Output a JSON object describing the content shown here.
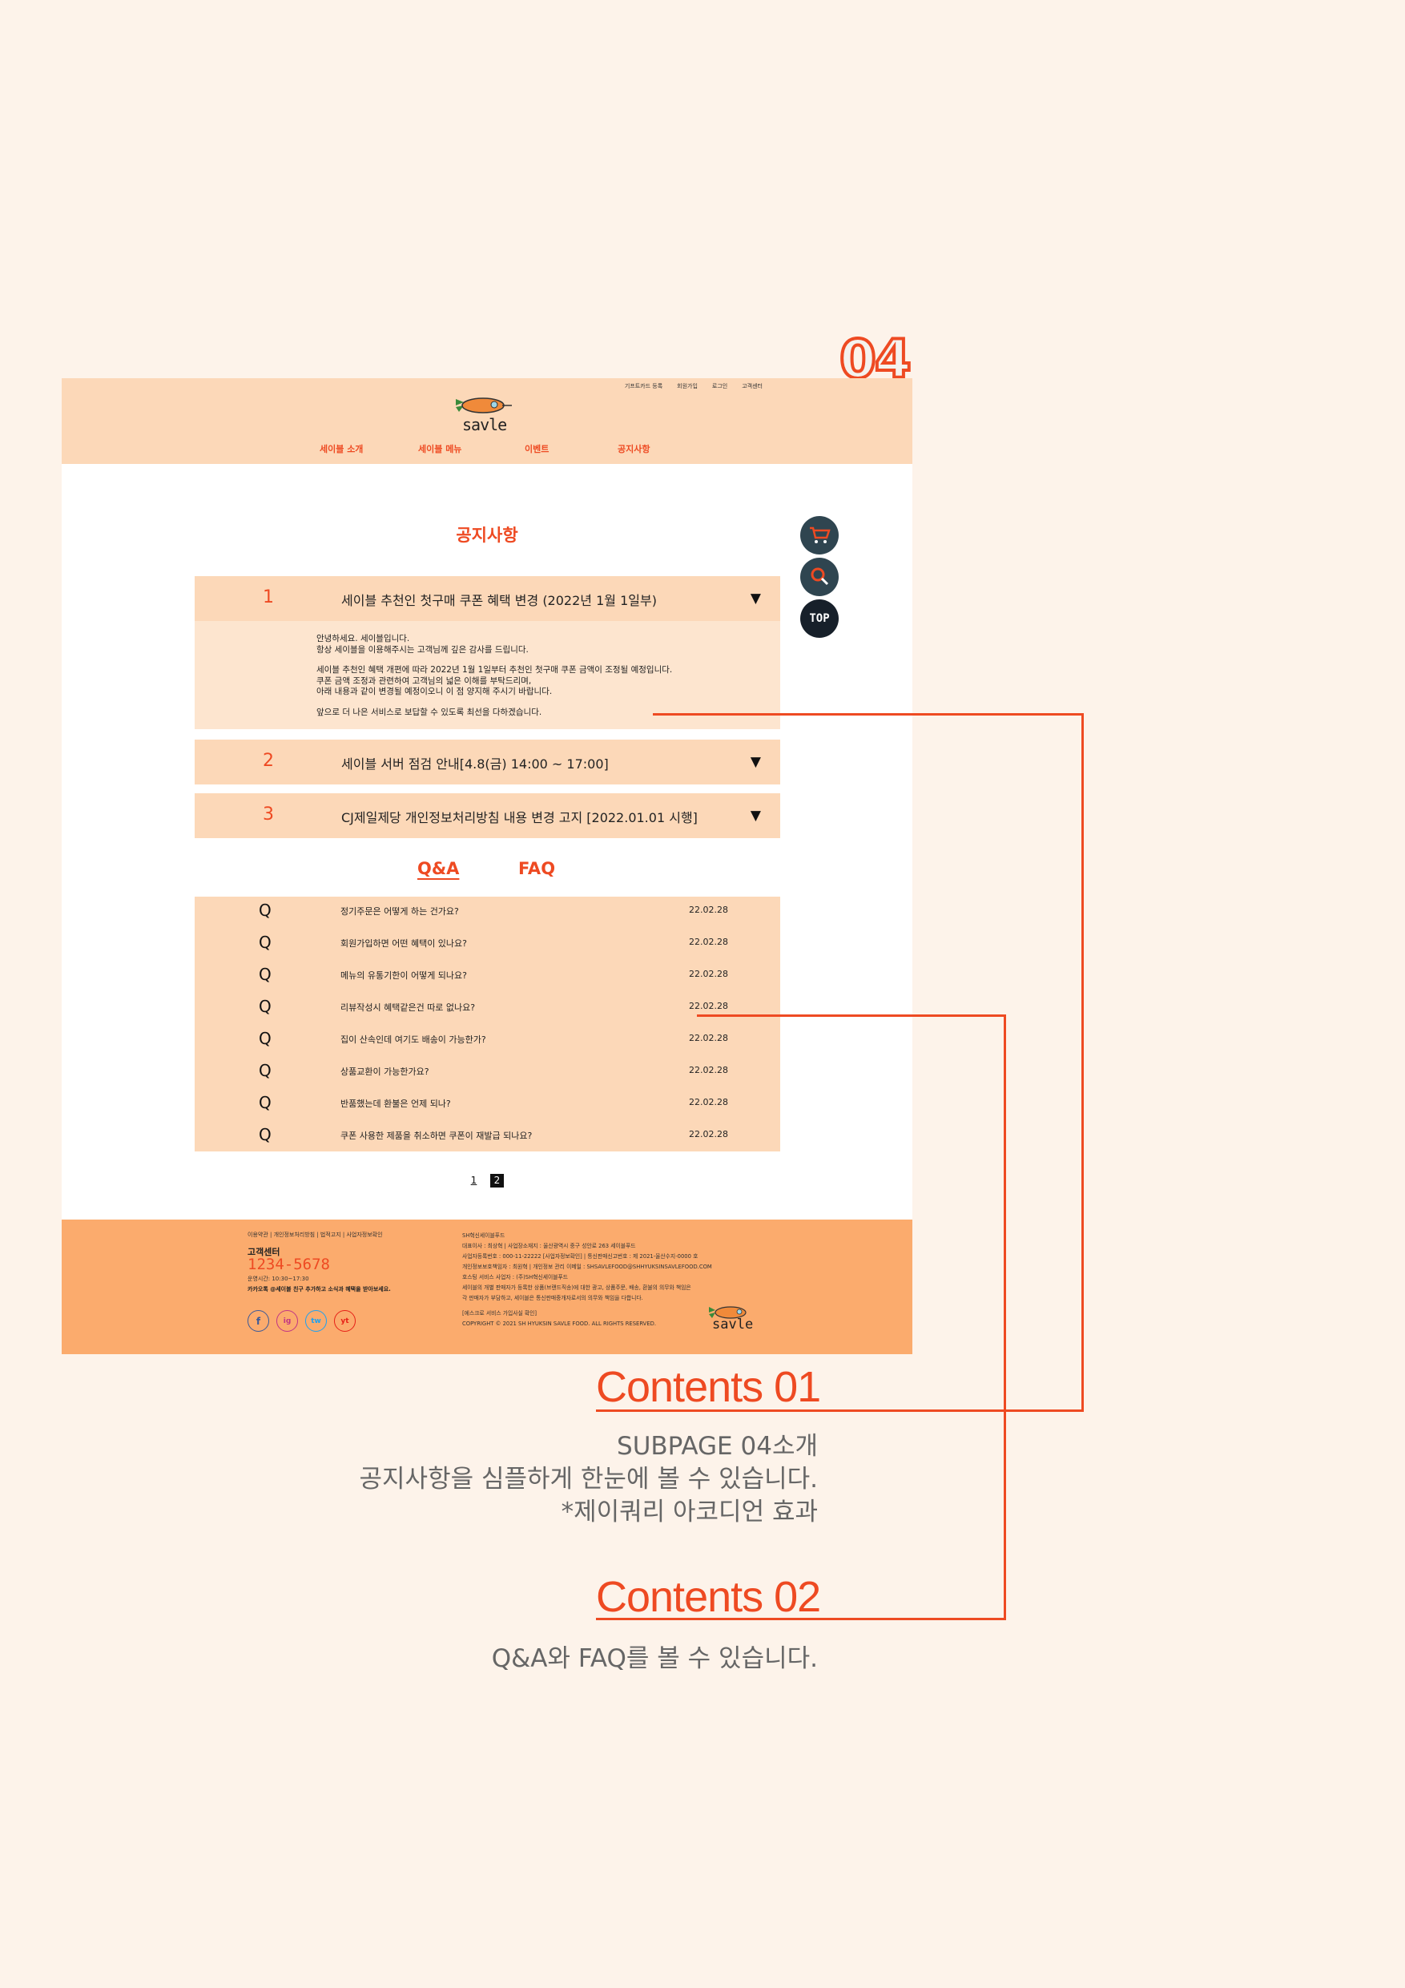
{
  "page_number": "04",
  "site": {
    "util_links": [
      "기프트카드 등록",
      "회원가입",
      "로그인",
      "고객센터"
    ],
    "logo_text": "savle",
    "nav": [
      "세이블 소개",
      "세이블 메뉴",
      "이벤트",
      "공지사항"
    ]
  },
  "notice": {
    "title": "공지사항",
    "items": [
      {
        "num": "1",
        "title": "세이블 추천인 첫구매 쿠폰 혜택 변경 (2022년 1월 1일부)",
        "body": [
          "안녕하세요. 세이블입니다.",
          "항상 세이블을 이용해주시는 고객님께 깊은 감사를 드립니다.",
          "",
          "세이블 추천인 혜택 개편에 따라 2022년 1월 1일부터 추천인 첫구매 쿠폰 금액이 조정될 예정입니다.",
          "쿠폰 금액 조정과 관련하여 고객님의 넓은 이해를 부탁드리며,",
          "아래 내용과 같이 변경될 예정이오니 이 점 양지해 주시기 바랍니다.",
          "",
          "앞으로 더 나은 서비스로 보답할 수 있도록 최선을 다하겠습니다."
        ]
      },
      {
        "num": "2",
        "title": "세이블 서버 점검 안내[4.8(금) 14:00 ~ 17:00]"
      },
      {
        "num": "3",
        "title": "CJ제일제당 개인정보처리방침 내용 변경 고지 [2022.01.01 시행]"
      }
    ],
    "caret": "▼"
  },
  "quick_menu": {
    "top_label": "TOP"
  },
  "tabs": {
    "qa": "Q&A",
    "faq": "FAQ"
  },
  "qa": {
    "marker": "Q",
    "rows": [
      {
        "text": "정기주문은 어떻게 하는 건가요?",
        "date": "22.02.28"
      },
      {
        "text": "회원가입하면 어떤 혜택이 있나요?",
        "date": "22.02.28"
      },
      {
        "text": "메뉴의 유통기한이 어떻게 되나요?",
        "date": "22.02.28"
      },
      {
        "text": "리뷰작성시 혜택같은건 따로 없나요?",
        "date": "22.02.28"
      },
      {
        "text": "집이 산속인데 여기도 배송이 가능한가?",
        "date": "22.02.28"
      },
      {
        "text": "상품교환이 가능한가요?",
        "date": "22.02.28"
      },
      {
        "text": "반품했는데 환불은 언제 되나?",
        "date": "22.02.28"
      },
      {
        "text": "쿠폰 사용한 제품을 취소하면 쿠폰이 재발급 되나요?",
        "date": "22.02.28"
      }
    ]
  },
  "pagination": [
    "1",
    "2"
  ],
  "footer": {
    "links": "이용약관 | 개인정보처리방침 | 법적고지 | 사업자정보확인",
    "cc_label": "고객센터",
    "tel": "1234-5678",
    "hours": "운영시간: 10:30~17:30",
    "kakao": "카카오톡 @세이블 친구 추가하고 소식과 혜택을 받아보세요.",
    "social": [
      "f",
      "ig",
      "tw",
      "yt"
    ],
    "info": [
      "SH혁신세이블푸드",
      "대표이사 : 최상혁 | 사업장소재지 : 울산광역시 중구 성안로 263 세이블푸드",
      "사업자등록번호 : 000-11-22222 [사업자정보확인] | 통신판매신고번호 : 제 2021-울산수지-0000 호",
      "개인정보보호책임자 : 최원혁 | 개인정보 관리 이메일 : SHSAVLEFOOD@SHHYUKSINSAVLEFOOD.COM",
      "호스팅 서비스 사업자 : (주)SH혁신세이블푸드",
      "세이블의 개별 판매자가 등록한 상품(브랜드직송)에 대한 광고, 상품주문, 배송, 환불의 의무와 책임은",
      "각 판매자가 부담하고, 세이블은 통신판매중개자로서의 의무와 책임을 다합니다.",
      "",
      "[에스크로 서비스 가입사실 확인]",
      "COPYRIGHT © 2021 SH HYUKSIN SAVLE FOOD. ALL RIGHTS RESERVED."
    ],
    "logo_text": "savle"
  },
  "annotations": {
    "c1_title": "Contents 01",
    "c1_desc": [
      "SUBPAGE 04소개",
      "공지사항을  심플하게 한눈에  볼 수 있습니다.",
      "*제이쿼리 아코디언 효과"
    ],
    "c2_title": "Contents 02",
    "c2_desc": [
      "Q&A와 FAQ를 볼 수 있습니다."
    ]
  },
  "colors": {
    "accent": "#ee4a22",
    "header_bg": "#fcd8b8",
    "footer_bg": "#fbab6d",
    "page_bg": "#fdf3ea"
  }
}
